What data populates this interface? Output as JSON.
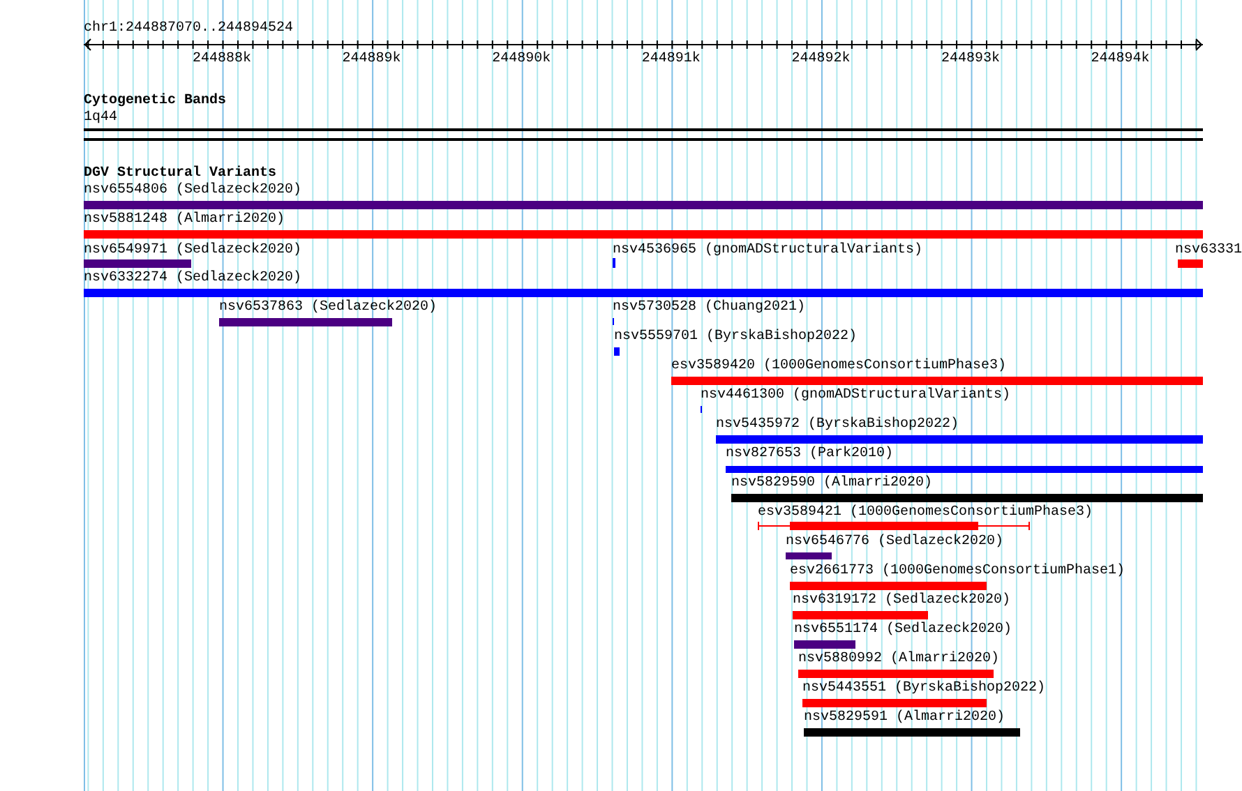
{
  "ruler": {
    "location": "chr1:244887070..244894524",
    "ticks": [
      "244888k",
      "244889k",
      "244890k",
      "244891k",
      "244892k",
      "244893k",
      "244894k"
    ]
  },
  "tracks": [
    {
      "title": "Cytogenetic Bands",
      "kind": "bands",
      "items": [
        {
          "label": "1q44"
        }
      ]
    },
    {
      "title": "DGV Structural Variants",
      "kind": "variants",
      "features": [
        {
          "label": "nsv6554806 (Sedlazeck2020)",
          "color": "#4b0082",
          "kind": "bar"
        },
        {
          "label": "nsv5881248 (Almarri2020)",
          "color": "#ff0000",
          "kind": "bar"
        },
        {
          "label": "nsv6549971 (Sedlazeck2020)",
          "color": "#4b0082",
          "kind": "bar"
        },
        {
          "label": "nsv4536965 (gnomADStructuralVariants)",
          "color": "#0000ff",
          "kind": "bar"
        },
        {
          "label": "nsv63331",
          "color": "#ff0000",
          "kind": "bar"
        },
        {
          "label": "nsv6332274 (Sedlazeck2020)",
          "color": "#0000ff",
          "kind": "bar"
        },
        {
          "label": "nsv6537863 (Sedlazeck2020)",
          "color": "#4b0082",
          "kind": "bar"
        },
        {
          "label": "nsv5730528 (Chuang2021)",
          "color": "#0000ff",
          "kind": "bar"
        },
        {
          "label": "nsv5559701 (ByrskaBishop2022)",
          "color": "#0000ff",
          "kind": "bar"
        },
        {
          "label": "esv3589420 (1000GenomesConsortiumPhase3)",
          "color": "#ff0000",
          "kind": "bar"
        },
        {
          "label": "nsv4461300 (gnomADStructuralVariants)",
          "color": "#0000ff",
          "kind": "bar"
        },
        {
          "label": "nsv5435972 (ByrskaBishop2022)",
          "color": "#0000ff",
          "kind": "bar"
        },
        {
          "label": "nsv827653 (Park2010)",
          "color": "#0000ff",
          "kind": "bar"
        },
        {
          "label": "nsv5829590 (Almarri2020)",
          "color": "#000000",
          "kind": "bar"
        },
        {
          "label": "esv3589421 (1000GenomesConsortiumPhase3)",
          "color": "#ff0000",
          "kind": "range"
        },
        {
          "label": "nsv6546776 (Sedlazeck2020)",
          "color": "#4b0082",
          "kind": "bar"
        },
        {
          "label": "esv2661773 (1000GenomesConsortiumPhase1)",
          "color": "#ff0000",
          "kind": "bar"
        },
        {
          "label": "nsv6319172 (Sedlazeck2020)",
          "color": "#ff0000",
          "kind": "bar"
        },
        {
          "label": "nsv6551174 (Sedlazeck2020)",
          "color": "#4b0082",
          "kind": "bar"
        },
        {
          "label": "nsv5880992 (Almarri2020)",
          "color": "#ff0000",
          "kind": "bar"
        },
        {
          "label": "nsv5443551 (ByrskaBishop2022)",
          "color": "#ff0000",
          "kind": "bar"
        },
        {
          "label": "nsv5829591 (Almarri2020)",
          "color": "#000000",
          "kind": "bar"
        }
      ]
    }
  ]
}
